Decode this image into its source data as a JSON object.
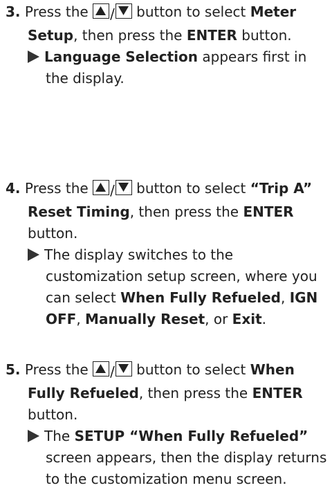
{
  "steps": [
    {
      "number": "3.",
      "press": "Press the",
      "slash": "/",
      "after_keys": "button to select",
      "target": "Meter Setup",
      "then": ", then press the",
      "enter": "ENTER",
      "button_end": "button.",
      "result": {
        "bold": "Language Selection",
        "text": "appears first in the display."
      }
    },
    {
      "number": "4.",
      "press": "Press the",
      "slash": "/",
      "after_keys": "button to select",
      "target": "“Trip A” Reset Timing",
      "then": ", then press the",
      "enter": "ENTER",
      "button_end": "button.",
      "result": {
        "t1": "The display switches to the customization setup screen, where you can select",
        "o1": "When Fully Refueled",
        "c1": ",",
        "o2": "IGN OFF",
        "c2": ",",
        "o3": "Manually Reset",
        "c3": ", or",
        "o4": "Exit",
        "end": "."
      }
    },
    {
      "number": "5.",
      "press": "Press the",
      "slash": "/",
      "after_keys": "button to select",
      "target": "When Fully Refueled",
      "then": ", then press the",
      "enter": "ENTER",
      "button_end": "button.",
      "result": {
        "pre": "The",
        "bold": "SETUP “When Fully Refueled”",
        "text": "screen appears, then the display returns to the customization menu screen."
      }
    }
  ]
}
